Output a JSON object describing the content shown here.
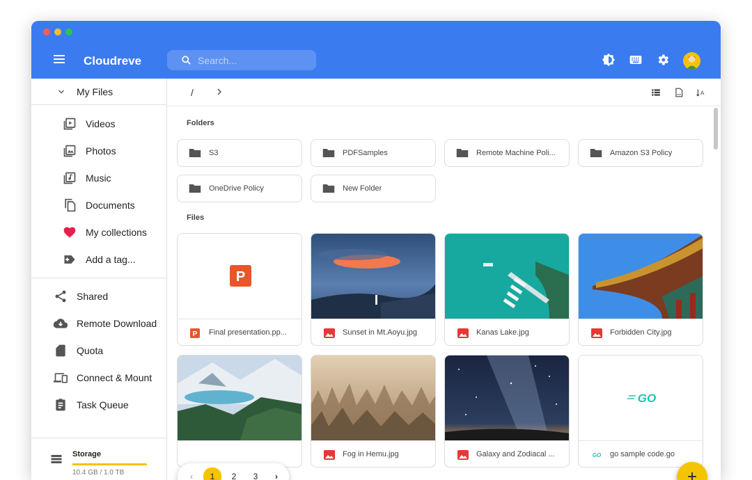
{
  "app": {
    "title": "Cloudreve"
  },
  "search": {
    "placeholder": "Search..."
  },
  "toolbar": {
    "icons": [
      "theme-icon",
      "keyboard-icon",
      "settings-icon",
      "avatar"
    ]
  },
  "sidebar": {
    "my_files": "My Files",
    "sub_items": [
      {
        "label": "Videos",
        "icon": "video-library-icon"
      },
      {
        "label": "Photos",
        "icon": "photo-library-icon"
      },
      {
        "label": "Music",
        "icon": "music-library-icon"
      },
      {
        "label": "Documents",
        "icon": "documents-icon"
      },
      {
        "label": "My collections",
        "icon": "heart-icon"
      },
      {
        "label": "Add a tag...",
        "icon": "add-tag-icon"
      }
    ],
    "items": [
      {
        "label": "Shared",
        "icon": "share-icon"
      },
      {
        "label": "Remote Download",
        "icon": "cloud-download-icon"
      },
      {
        "label": "Quota",
        "icon": "sd-card-icon"
      },
      {
        "label": "Connect & Mount",
        "icon": "devices-icon"
      },
      {
        "label": "Task Queue",
        "icon": "assignment-icon"
      }
    ],
    "storage": {
      "label": "Storage",
      "value": "10.4 GB / 1.0 TB",
      "used_fraction": 0.01
    }
  },
  "path": {
    "root": "/"
  },
  "sections": {
    "folders": "Folders",
    "files": "Files"
  },
  "folders": [
    "S3",
    "PDFSamples",
    "Remote Machine Poli...",
    "Amazon S3 Policy",
    "OneDrive Policy",
    "New Folder"
  ],
  "files": [
    {
      "name": "Final presentation.pp...",
      "type": "ppt"
    },
    {
      "name": "Sunset in Mt.Aoyu.jpg",
      "type": "image"
    },
    {
      "name": "Kanas Lake.jpg",
      "type": "image"
    },
    {
      "name": "Forbidden City.jpg",
      "type": "image"
    },
    {
      "name": "",
      "type": "image"
    },
    {
      "name": "Fog in Hemu.jpg",
      "type": "image"
    },
    {
      "name": "Galaxy and Zodiacal ...",
      "type": "image"
    },
    {
      "name": "go sample code.go",
      "type": "go"
    }
  ],
  "pagination": {
    "pages": [
      "1",
      "2",
      "3"
    ],
    "current": "1",
    "prev": "‹",
    "next": "›"
  },
  "fab": {
    "label": "+"
  },
  "colors": {
    "appbar": "#3b7bf0",
    "accent": "#f5c400",
    "image_icon": "#e53935",
    "ppt": "#e8562a",
    "go": "#29beb0"
  }
}
